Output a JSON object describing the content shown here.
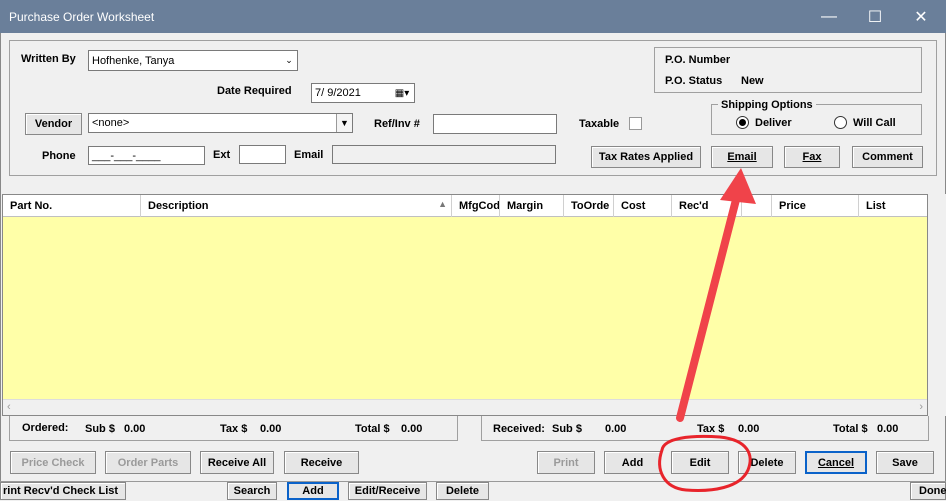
{
  "window": {
    "title": "Purchase Order Worksheet",
    "minimize_glyph": "—",
    "maximize_glyph": "☐",
    "close_glyph": "✕"
  },
  "header": {
    "written_by_label": "Written By",
    "written_by_value": "Hofhenke, Tanya",
    "date_required_label": "Date Required",
    "date_required_value": "7/  9/2021",
    "vendor_button": "Vendor",
    "vendor_value": "<none>",
    "ref_inv_label": "Ref/Inv #",
    "ref_inv_value": "",
    "taxable_label": "Taxable",
    "phone_label": "Phone",
    "phone_value": "___-___-____",
    "ext_label": "Ext",
    "ext_value": "",
    "email_label": "Email",
    "email_value": ""
  },
  "po_info": {
    "number_label": "P.O. Number",
    "number_value": "",
    "status_label": "P.O. Status",
    "status_value": "New"
  },
  "shipping": {
    "title": "Shipping Options",
    "deliver_label": "Deliver",
    "will_call_label": "Will Call"
  },
  "action_buttons": {
    "tax_rates": "Tax Rates Applied",
    "email": "Email",
    "fax": "Fax",
    "comment": "Comment"
  },
  "grid": {
    "columns": [
      "Part No.",
      "Description",
      "MfgCod",
      "Margin",
      "ToOrde",
      "Cost",
      "Rec'd",
      "",
      "Price",
      "List"
    ]
  },
  "ordered": {
    "label": "Ordered:",
    "sub_label": "Sub $",
    "sub_value": "0.00",
    "tax_label": "Tax $",
    "tax_value": "0.00",
    "total_label": "Total $",
    "total_value": "0.00"
  },
  "received": {
    "label": "Received:",
    "sub_label": "Sub $",
    "sub_value": "0.00",
    "tax_label": "Tax $",
    "tax_value": "0.00",
    "total_label": "Total $",
    "total_value": "0.00"
  },
  "bottom_buttons": {
    "price_check": "Price Check",
    "order_parts": "Order Parts",
    "receive_all": "Receive All",
    "receive": "Receive",
    "print": "Print",
    "add": "Add",
    "edit": "Edit",
    "delete": "Delete",
    "cancel": "Cancel",
    "save": "Save"
  },
  "background_window": {
    "print_recvd": "rint Recv'd Check List",
    "search": "Search",
    "add": "Add",
    "edit_receive": "Edit/Receive",
    "delete": "Delete",
    "done": "Done"
  },
  "annotation_colors": {
    "arrow": "#f0434a",
    "circle": "#e8242b"
  }
}
